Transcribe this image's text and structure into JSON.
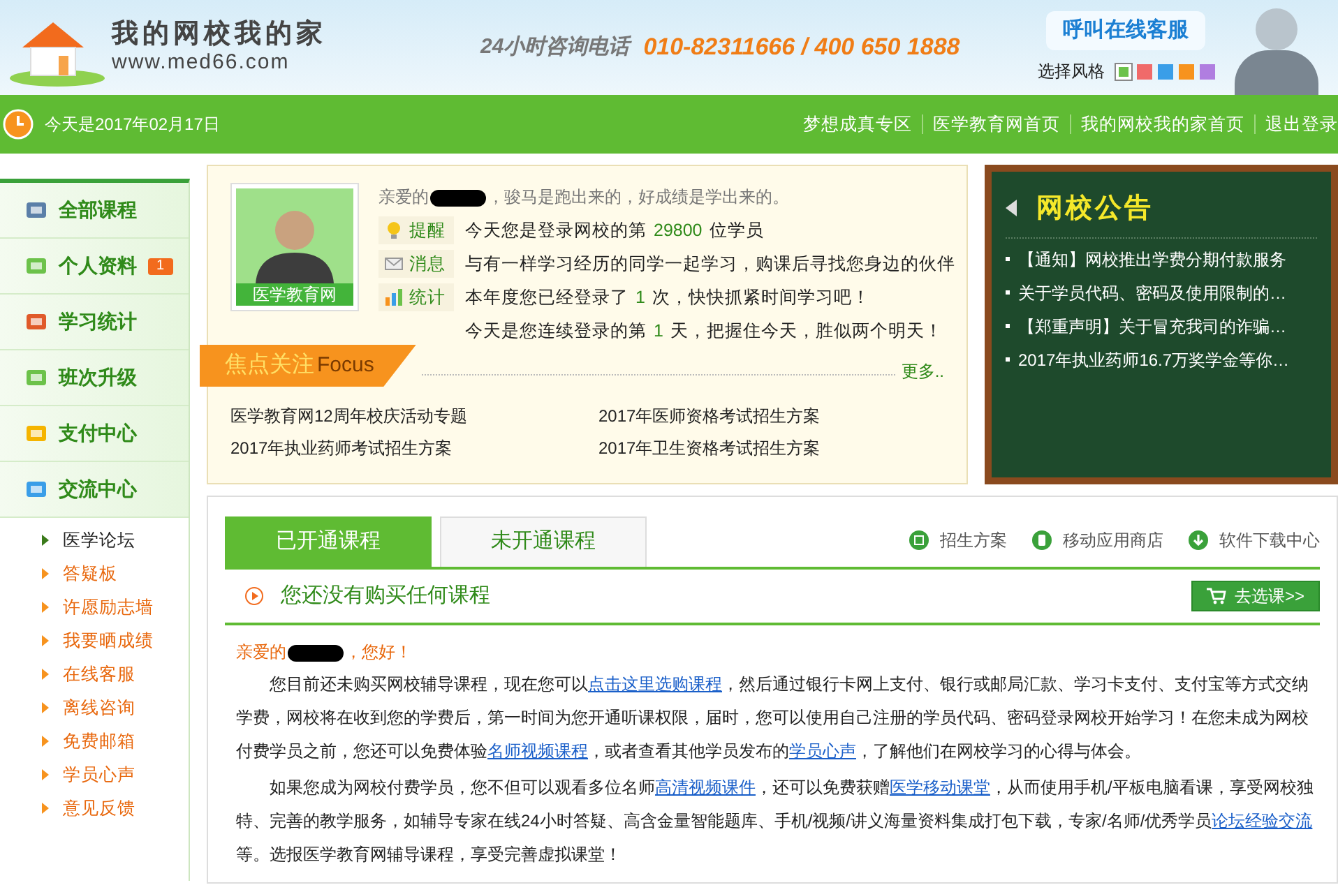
{
  "header": {
    "site_name": "我的网校我的家",
    "site_url": "www.med66.com",
    "hotline_label": "24小时咨询电话",
    "hotline_numbers": "010-82311666 / 400 650 1888",
    "service_button": "呼叫在线客服",
    "style_label": "选择风格",
    "styles": [
      {
        "color": "#6cc24a",
        "selected": true
      },
      {
        "color": "#f06a6a",
        "selected": false
      },
      {
        "color": "#3a9ee8",
        "selected": false
      },
      {
        "color": "#f7931e",
        "selected": false
      },
      {
        "color": "#b07ee0",
        "selected": false
      }
    ]
  },
  "topbar": {
    "date": "今天是2017年02月17日",
    "links": [
      "梦想成真专区",
      "医学教育网首页",
      "我的网校我的家首页",
      "退出登录"
    ]
  },
  "sidebar": {
    "items": [
      {
        "label": "全部课程"
      },
      {
        "label": "个人资料",
        "badge": "1"
      },
      {
        "label": "学习统计"
      },
      {
        "label": "班次升级"
      },
      {
        "label": "支付中心"
      },
      {
        "label": "交流中心"
      }
    ],
    "subitems": [
      {
        "label": "医学论坛",
        "kind": "plain"
      },
      {
        "label": "答疑板",
        "kind": "highlight"
      },
      {
        "label": "许愿励志墙",
        "kind": "highlight"
      },
      {
        "label": "我要晒成绩",
        "kind": "highlight"
      },
      {
        "label": "在线客服",
        "kind": "highlight"
      },
      {
        "label": "离线咨询",
        "kind": "highlight"
      },
      {
        "label": "免费邮箱",
        "kind": "highlight"
      },
      {
        "label": "学员心声",
        "kind": "highlight"
      },
      {
        "label": "意见反馈",
        "kind": "highlight"
      }
    ]
  },
  "profile": {
    "avatar_caption": "医学教育网",
    "greeting_before": "亲爱的",
    "greeting_after": "，骏马是跑出来的，好成绩是学出来的。",
    "rows": [
      {
        "label": "提醒",
        "kind": "bulb",
        "before": "今天您是登录网校的第",
        "number": "29800",
        "after": "位学员"
      },
      {
        "label": "消息",
        "kind": "mail",
        "before": "与有一样学习经历的同学一起学习，购课后寻找您身边的伙伴",
        "number": "",
        "after": ""
      },
      {
        "label": "统计",
        "kind": "chart",
        "before": "本年度您已经登录了",
        "number": "1",
        "after": "次，快快抓紧时间学习吧！"
      },
      {
        "label": "",
        "kind": "none",
        "before": "今天是您连续登录的第",
        "number": "1",
        "after": "天，把握住今天，胜似两个明天！"
      }
    ]
  },
  "focus": {
    "title": "焦点关注",
    "title_en": "Focus",
    "more": "更多..",
    "links": [
      "医学教育网12周年校庆活动专题",
      "2017年医师资格考试招生方案",
      "2017年执业药师考试招生方案",
      "2017年卫生资格考试招生方案"
    ]
  },
  "notice_board": {
    "title": "网校公告",
    "items": [
      "【通知】网校推出学费分期付款服务",
      "关于学员代码、密码及使用限制的…",
      "【郑重声明】关于冒充我司的诈骗…",
      "2017年执业药师16.7万奖学金等你…"
    ]
  },
  "courses": {
    "tabs": [
      {
        "label": "已开通课程",
        "selected": true
      },
      {
        "label": "未开通课程",
        "selected": false
      }
    ],
    "links": [
      {
        "label": "招生方案",
        "kind": "list"
      },
      {
        "label": "移动应用商店",
        "kind": "phone"
      },
      {
        "label": "软件下载中心",
        "kind": "download"
      }
    ],
    "empty_title": "您还没有购买任何课程",
    "choose_button": "去选课>>",
    "greeting_before": "亲爱的",
    "greeting_after": "，您好！",
    "paragraphs": [
      [
        {
          "kind": "text",
          "text": "您目前还未购买网校辅导课程，现在您可以"
        },
        {
          "kind": "link",
          "text": "点击这里选购课程"
        },
        {
          "kind": "text",
          "text": "，然后通过银行卡网上支付、银行或邮局汇款、学习卡支付、支付宝等方式交纳学费，网校将在收到您的学费后，第一时间为您开通听课权限，届时，您可以使用自己注册的学员代码、密码登录网校开始学习！在您未成为网校付费学员之前，您还可以免费体验"
        },
        {
          "kind": "link",
          "text": "名师视频课程"
        },
        {
          "kind": "text",
          "text": "，或者查看其他学员发布的"
        },
        {
          "kind": "link",
          "text": "学员心声"
        },
        {
          "kind": "text",
          "text": "，了解他们在网校学习的心得与体会。"
        }
      ],
      [
        {
          "kind": "text",
          "text": "如果您成为网校付费学员，您不但可以观看多位名师"
        },
        {
          "kind": "link",
          "text": "高清视频课件"
        },
        {
          "kind": "text",
          "text": "，还可以免费获赠"
        },
        {
          "kind": "link",
          "text": "医学移动课堂"
        },
        {
          "kind": "text",
          "text": "，从而使用手机/平板电脑看课，享受网校独特、完善的教学服务，如辅导专家在线24小时答疑、高含金量智能题库、手机/视频/讲义海量资料集成打包下载，专家/名师/优秀学员"
        },
        {
          "kind": "link",
          "text": "论坛经验交流"
        },
        {
          "kind": "text",
          "text": "等。选报医学教育网辅导课程，享受完善虚拟课堂！"
        }
      ]
    ]
  }
}
